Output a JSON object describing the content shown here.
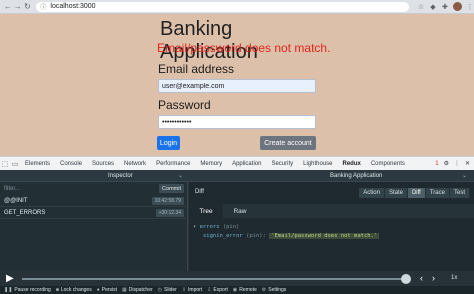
{
  "browser": {
    "url": "localhost:3000",
    "back_icon": "arrow-left-icon",
    "forward_icon": "arrow-right-icon",
    "reload_icon": "reload-icon",
    "lock_icon": "info-icon"
  },
  "app": {
    "title": "Banking Application",
    "error": "Email/password does not match.",
    "email_label": "Email address",
    "email_value": "user@example.com",
    "password_label": "Password",
    "password_value": "••••••••••••",
    "login_label": "Login",
    "create_label": "Create account",
    "colors": {
      "background": "#ddc0aa",
      "error": "#e2241a",
      "login": "#1a73e8",
      "create": "#6c757d"
    }
  },
  "devtools": {
    "tabs": [
      "Elements",
      "Console",
      "Sources",
      "Network",
      "Performance",
      "Memory",
      "Application",
      "Security",
      "Lighthouse",
      "Redux",
      "Components"
    ],
    "active_tab": "Redux",
    "error_count": "1"
  },
  "redux": {
    "inspector_label": "Inspector",
    "instance": "Banking Application",
    "filter_placeholder": "filter...",
    "commit_label": "Commit",
    "actions": [
      {
        "name": "@@INIT",
        "time": "10:42:58.79"
      },
      {
        "name": "GET_ERRORS",
        "time": "+30:12.34"
      }
    ],
    "panel_title": "Diff",
    "modes": [
      "Action",
      "State",
      "Diff",
      "Trace",
      "Test"
    ],
    "active_mode": "Diff",
    "sub_tabs": [
      "Tree",
      "Raw"
    ],
    "active_sub_tab": "Tree",
    "tree": {
      "root_key": "errors",
      "root_type": "(pin)",
      "child_key": "signin_error",
      "child_type": "(pin):",
      "child_value": "'Email/password does not match.'"
    },
    "slider": {
      "position_percent": 100,
      "speed": "1x"
    },
    "bottom_buttons": [
      {
        "label": "Pause recording",
        "icon": "pause-icon"
      },
      {
        "label": "Lock changes",
        "icon": "lock-icon"
      },
      {
        "label": "Persist",
        "icon": "pin-icon"
      },
      {
        "label": "Dispatcher",
        "icon": "keyboard-icon"
      },
      {
        "label": "Slider",
        "icon": "history-icon"
      },
      {
        "label": "Import",
        "icon": "upload-icon"
      },
      {
        "label": "Export",
        "icon": "download-icon"
      },
      {
        "label": "Remote",
        "icon": "remote-icon"
      },
      {
        "label": "Settings",
        "icon": "gear-icon"
      }
    ]
  }
}
